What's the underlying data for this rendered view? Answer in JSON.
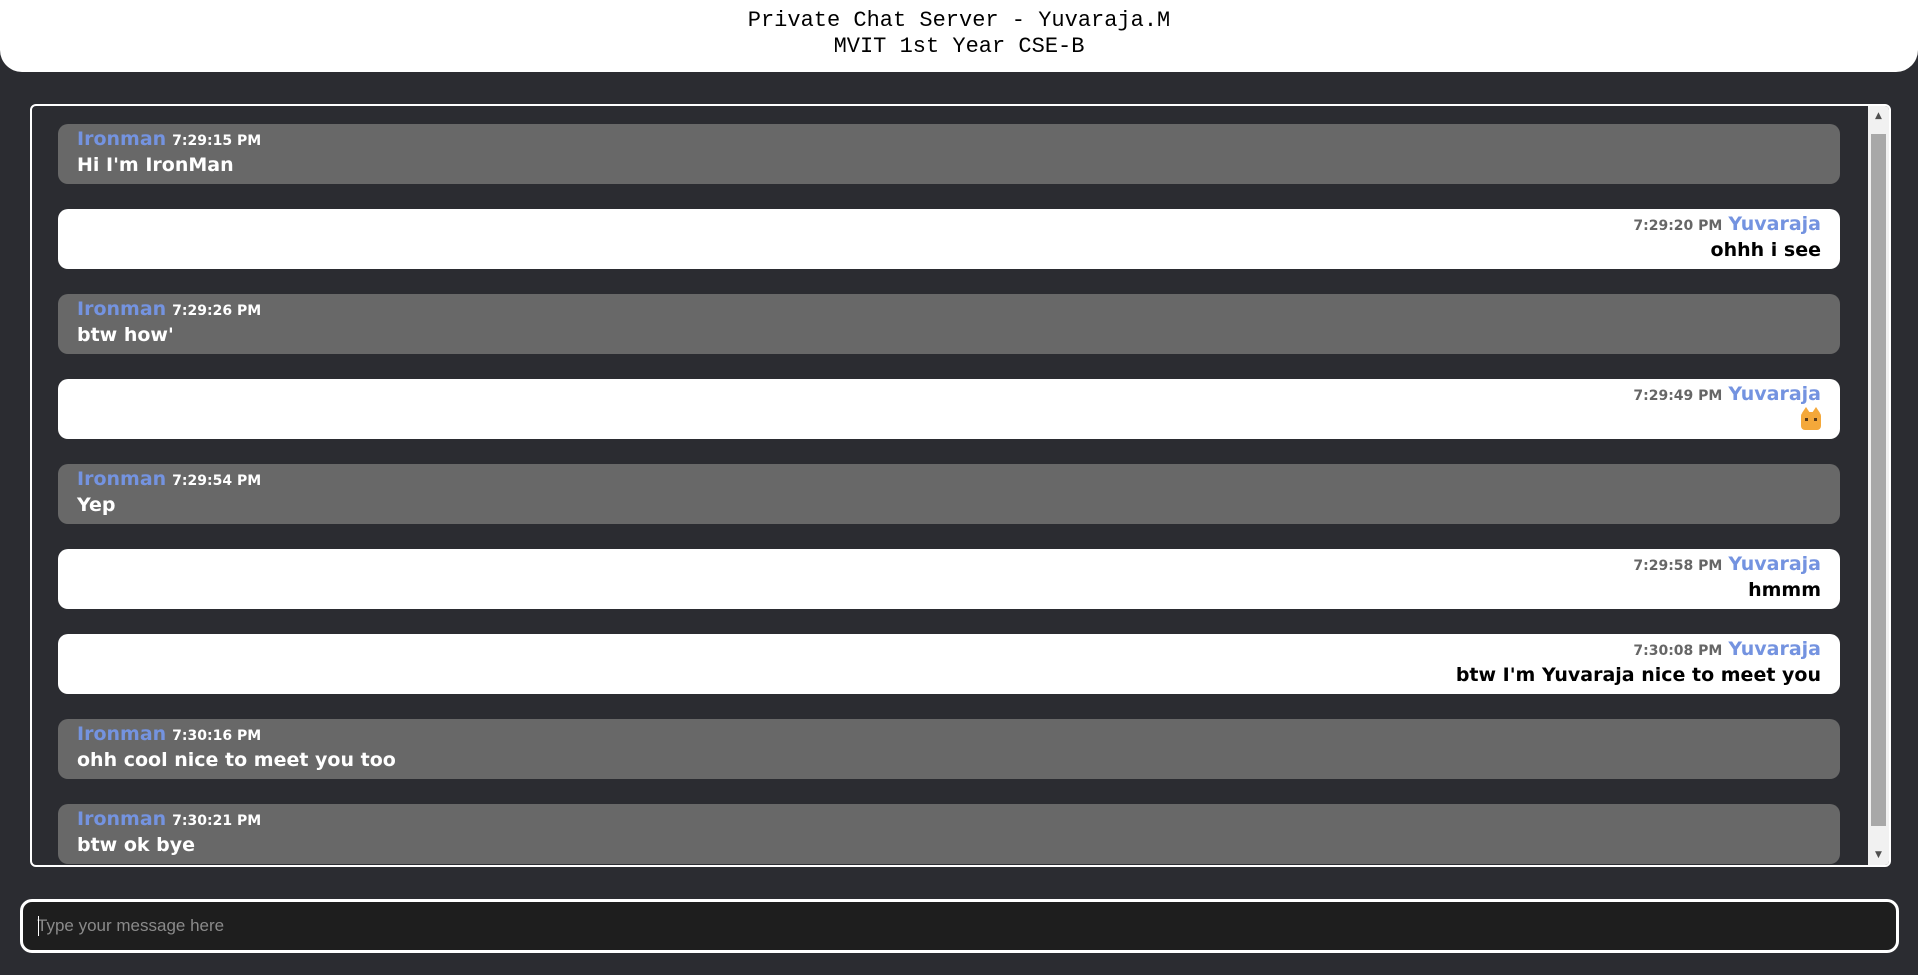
{
  "header": {
    "title": "Private Chat Server - Yuvaraja.M",
    "subtitle": "MVIT 1st Year CSE-B"
  },
  "messages": [
    {
      "direction": "in",
      "sender": "Ironman",
      "time": "7:29:15 PM",
      "text": "Hi I'm IronMan"
    },
    {
      "direction": "out",
      "sender": "Yuvaraja",
      "time": "7:29:20 PM",
      "text": "ohhh i see"
    },
    {
      "direction": "in",
      "sender": "Ironman",
      "time": "7:29:26 PM",
      "text": "btw how'"
    },
    {
      "direction": "out",
      "sender": "Yuvaraja",
      "time": "7:29:49 PM",
      "text": "",
      "emoji": "cat-face-icon"
    },
    {
      "direction": "in",
      "sender": "Ironman",
      "time": "7:29:54 PM",
      "text": "Yep"
    },
    {
      "direction": "out",
      "sender": "Yuvaraja",
      "time": "7:29:58 PM",
      "text": "hmmm"
    },
    {
      "direction": "out",
      "sender": "Yuvaraja",
      "time": "7:30:08 PM",
      "text": "btw I'm Yuvaraja nice to meet you"
    },
    {
      "direction": "in",
      "sender": "Ironman",
      "time": "7:30:16 PM",
      "text": "ohh cool nice to meet you too"
    },
    {
      "direction": "in",
      "sender": "Ironman",
      "time": "7:30:21 PM",
      "text": "btw ok bye"
    }
  ],
  "composer": {
    "placeholder": "Type your message here",
    "value": ""
  },
  "colors": {
    "background": "#2b2c31",
    "incoming_bubble": "#686868",
    "outgoing_bubble": "#ffffff",
    "sender_name": "#7493e0"
  }
}
